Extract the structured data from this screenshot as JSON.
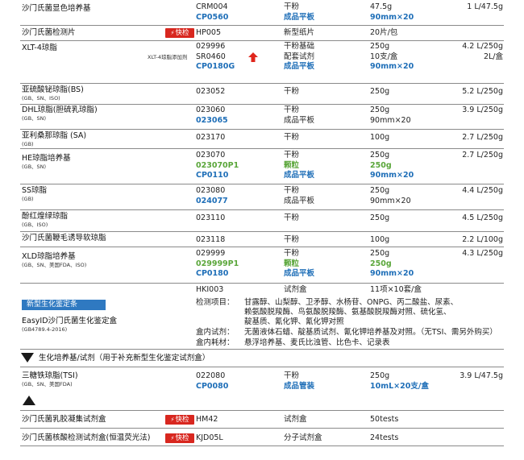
{
  "products": [
    {
      "name": "沙门氏菌显色培养基",
      "rows": [
        {
          "code": "CRM004",
          "type": "干粉",
          "spec": "47.5g",
          "price": "1 L/47.5g"
        },
        {
          "code": "CP0560",
          "type": "成品平板",
          "spec": "90mm×20",
          "blue": true
        }
      ]
    },
    {
      "name": "沙门氏菌检测片",
      "badge": "快检",
      "rows": [
        {
          "code": "HP005",
          "type": "新型纸片",
          "spec": "20片/包"
        }
      ]
    },
    {
      "name": "XLT-4琼脂",
      "rows": [
        {
          "code": "029996",
          "type": "干粉基础",
          "spec": "250g",
          "price": "4.2 L/250g"
        },
        {
          "code": "SR0460",
          "type": "配套试剂",
          "spec": "10支/盒",
          "price": "2L/盒",
          "label": "XLT-4琼脂添加剂"
        },
        {
          "code": "CP0180G",
          "type": "成品平板",
          "spec": "90mm×20",
          "blue": true
        }
      ]
    },
    {
      "name": "亚硫酸铋琼脂(BS)",
      "std": "(GB、SN、ISO)",
      "rows": [
        {
          "code": "023052",
          "type": "干粉",
          "spec": "250g",
          "price": "5.2 L/250g"
        }
      ]
    },
    {
      "name": "DHL琼脂(胆硫乳琼脂)",
      "std": "(GB、SN)",
      "rows": [
        {
          "code": "023060",
          "type": "干粉",
          "spec": "250g",
          "price": "3.9 L/250g"
        },
        {
          "code": "023065",
          "type": "成品平板",
          "spec": "90mm×20",
          "bluecode": true
        }
      ]
    },
    {
      "name": "亚利桑那琼脂 (SA)",
      "std": "(GB)",
      "rows": [
        {
          "code": "023170",
          "type": "干粉",
          "spec": "100g",
          "price": "2.7 L/250g"
        }
      ]
    },
    {
      "name": "HE琼脂培养基",
      "std": "(GB、SN)",
      "rows": [
        {
          "code": "023070",
          "type": "干粉",
          "spec": "250g",
          "price": "2.7 L/250g"
        },
        {
          "code": "023070P1",
          "type": "颗粒",
          "spec": "250g",
          "green": true
        },
        {
          "code": "CP0110",
          "type": "成品平板",
          "spec": "90mm×20",
          "blue": true
        }
      ]
    },
    {
      "name": "SS琼脂",
      "std": "(GB)",
      "rows": [
        {
          "code": "023080",
          "type": "干粉",
          "spec": "250g",
          "price": "4.4 L/250g"
        },
        {
          "code": "024077",
          "type": "成品平板",
          "spec": "90mm×20",
          "bluecode": true
        }
      ]
    },
    {
      "name": "酚红煌绿琼脂",
      "std": "(GB、ISO)",
      "rows": [
        {
          "code": "023110",
          "type": "干粉",
          "spec": "250g",
          "price": "4.5 L/250g"
        }
      ]
    },
    {
      "name": "沙门氏菌鞭毛诱导软琼脂",
      "rows": [
        {
          "code": "023118",
          "type": "干粉",
          "spec": "100g",
          "price": "2.2 L/100g"
        }
      ]
    },
    {
      "name": "XLD琼脂培养基",
      "std": "(GB、SN、美国FDA、ISO)",
      "rows": [
        {
          "code": "029999",
          "type": "干粉",
          "spec": "250g",
          "price": "4.3 L/250g"
        },
        {
          "code": "029999P1",
          "type": "颗粒",
          "spec": "250g",
          "green": true
        },
        {
          "code": "CP0180",
          "type": "成品平板",
          "spec": "90mm×20",
          "blue": true
        }
      ]
    }
  ],
  "biochem": {
    "tag": "新型生化鉴定条",
    "name": "EasyID沙门氏菌生化鉴定盒",
    "std": "(GB4789.4-2016)",
    "code": "HKI003",
    "type": "试剂盒",
    "spec": "11项×10套/盒",
    "items_label": "检测项目：",
    "items_1": "甘露醇、山梨醇、卫矛醇、水杨苷、ONPG、丙二酸盐、尿素、",
    "items_2": "赖氨酸脱羧酶、鸟氨酸脱羧酶、氨基酸脱羧酶对照、硫化氢、",
    "items_3": "靛基质、氰化钾、氰化钾对照",
    "reagent_label": "盒内试剂：",
    "reagent": "无菌液体石蜡、靛基质试剂、氰化钾培养基及对照。（无TSI、需另外购买）",
    "consumable_label": "盒内耗材：",
    "consumable": "悬浮培养基、麦氏比浊管、比色卡、记录表"
  },
  "section2": {
    "title": "生化培养基/试剂（用于补充新型生化鉴定试剂盒）"
  },
  "tsi": {
    "name": "三糖铁琼脂(TSI)",
    "std": "(GB、SN、美国FDA)",
    "rows": [
      {
        "code": "022080",
        "type": "干粉",
        "spec": "250g",
        "price": "3.9 L/47.5g"
      },
      {
        "code": "CP0080",
        "type": "成品管装",
        "spec": "10mL×20支/盒",
        "blue": true
      }
    ]
  },
  "rapid": [
    {
      "name": "沙门氏菌乳胶凝集试剂盒",
      "badge": "快检",
      "code": "HM42",
      "type": "试剂盒",
      "spec": "50tests"
    },
    {
      "name": "沙门氏菌核酸检测试剂盒(恒温荧光法)",
      "badge": "快检",
      "code": "KJD05L",
      "type": "分子试剂盒",
      "spec": "24tests"
    }
  ],
  "colors": {
    "blue": "#1f6fb8",
    "green": "#5aa63a",
    "badge": "#d8271f",
    "tag": "#2f79c1",
    "arrow": "#e0261c"
  },
  "icons": {
    "badge_icon": "lightning-icon",
    "arrow": "red-up-arrow-icon",
    "triangle_down": "triangle-down-icon",
    "triangle_up": "triangle-up-icon"
  }
}
